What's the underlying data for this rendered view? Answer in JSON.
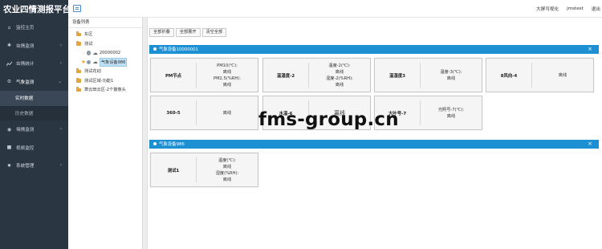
{
  "app": {
    "title": "农业四情测报平台"
  },
  "header": {
    "links": [
      "大屏可视化",
      "jmstest",
      "退出"
    ]
  },
  "sidebar": {
    "items": [
      {
        "label": "监控主页",
        "icon": "home-icon",
        "has_children": false
      },
      {
        "label": "虫情监测",
        "icon": "bug-icon",
        "has_children": true
      },
      {
        "label": "虫情统计",
        "icon": "chart-icon",
        "has_children": true
      },
      {
        "label": "气象监测",
        "icon": "gear-icon",
        "has_children": true,
        "expanded": true,
        "children": [
          {
            "label": "实时数据",
            "active": true
          },
          {
            "label": "历史数据"
          }
        ]
      },
      {
        "label": "墒情监测",
        "icon": "globe-icon",
        "has_children": true
      },
      {
        "label": "视频监控",
        "icon": "video-icon",
        "has_children": false
      },
      {
        "label": "系统管理",
        "icon": "settings-icon",
        "has_children": true
      }
    ]
  },
  "tree": {
    "title": "设备列表",
    "nodes": [
      {
        "label": "东区"
      },
      {
        "label": "测试"
      },
      {
        "label": "20000002"
      },
      {
        "label": "气象设备986"
      },
      {
        "label": "测试花动"
      },
      {
        "label": "测试区域-功能1"
      },
      {
        "label": "萧云田云区-2个摄像头"
      }
    ]
  },
  "toolbar": {
    "collapse_all": "全部折叠",
    "expand_all": "全部展开",
    "clear_all": "清空全部"
  },
  "panels": [
    {
      "title": "气象设备10000001",
      "cards": [
        {
          "name": "PM节点",
          "lines": [
            "PM10(℃):",
            "离线",
            "PM2.5(%RH):",
            "离线"
          ]
        },
        {
          "name": "温湿度-2",
          "lines": [
            "温度-2(℃):",
            "离线",
            "湿度-2(%RH):",
            "离线"
          ]
        },
        {
          "name": "温湿度3",
          "lines": [
            "温度-3(℃):",
            "离线"
          ]
        },
        {
          "name": "8风向-4",
          "lines": [
            "离线"
          ]
        },
        {
          "name": "360-5",
          "lines": [
            "离线"
          ]
        },
        {
          "name": "水温-6",
          "lines": [
            "离线"
          ],
          "big": true
        },
        {
          "name": "大叶号-7",
          "lines": [
            "光照号-7(℃):",
            "离线"
          ]
        }
      ]
    },
    {
      "title": "气象设备986",
      "cards": [
        {
          "name": "测试1",
          "lines": [
            "温度(℃):",
            "离线",
            "湿度(%RH):",
            "离线"
          ]
        }
      ]
    }
  ],
  "watermark": "fms-group.cn",
  "colors": {
    "sidebar_bg": "#2b3643",
    "panel_header": "#1d8fd3",
    "accent": "#4a8ed3"
  }
}
